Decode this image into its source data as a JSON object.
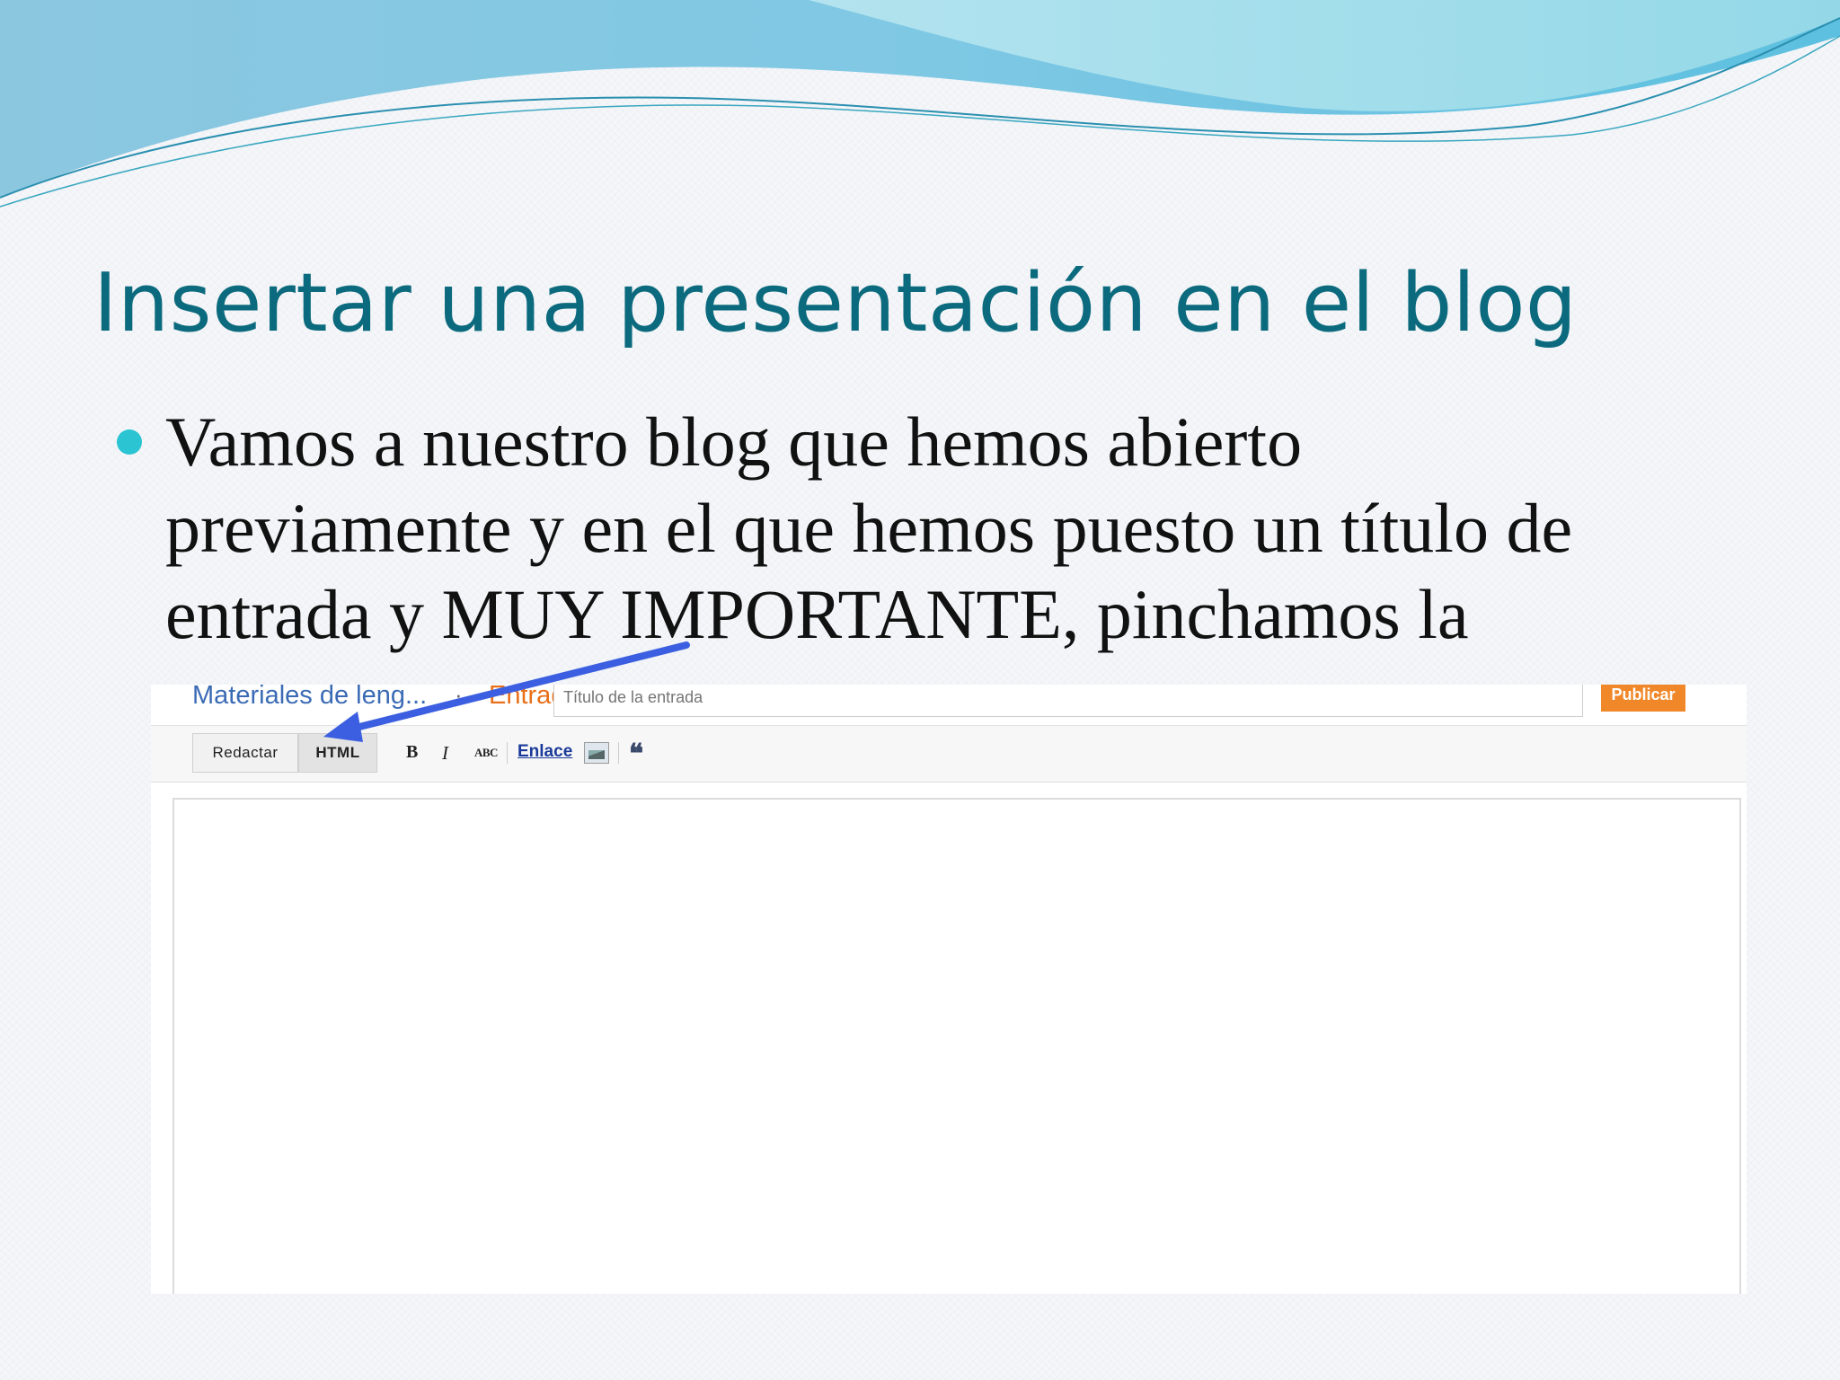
{
  "slide": {
    "title": "Insertar una presentación en el blog",
    "body_lines": [
      "Vamos a nuestro blog que hemos abierto",
      "previamente y en el que hemos puesto un título de",
      "entrada y MUY IMPORTANTE, pinchamos la"
    ]
  },
  "editor": {
    "blog_name": "Materiales de leng...",
    "crumb_separator": "·",
    "post_label": "Entrada",
    "title_placeholder": "Título de la entrada",
    "publish_label": "Publicar",
    "mode_compose_label": "Redactar",
    "mode_html_label": "HTML",
    "toolbar": {
      "bold_label": "B",
      "italic_label": "I",
      "spell_label": "ABC",
      "link_label": "Enlace",
      "image_icon": "image-icon",
      "quote_label": "❝"
    },
    "body_value": ""
  },
  "colors": {
    "title": "#0b6a7d",
    "bullet": "#2ac4d2",
    "arrow": "#3b5fe0",
    "publish": "#f0882a"
  }
}
